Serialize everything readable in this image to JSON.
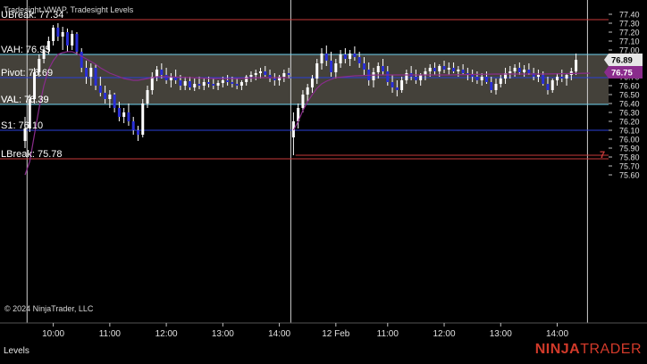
{
  "chart_data": {
    "type": "bar",
    "indicators_label": "Tradesight VWAP, Tradesight Levels",
    "copyright": "© 2024 NinjaTrader, LLC",
    "ylim": [
      75.55,
      77.42
    ],
    "y_ticks": [
      "77.40",
      "77.30",
      "77.20",
      "77.10",
      "77.00",
      "76.90",
      "76.80",
      "76.70",
      "76.60",
      "76.50",
      "76.40",
      "76.30",
      "76.20",
      "76.10",
      "76.00",
      "75.90",
      "75.80",
      "75.70",
      "75.60"
    ],
    "x_ticks": [
      {
        "label": "10:00",
        "slot": 6
      },
      {
        "label": "11:00",
        "slot": 18
      },
      {
        "label": "12:00",
        "slot": 30
      },
      {
        "label": "13:00",
        "slot": 42
      },
      {
        "label": "14:00",
        "slot": 54
      },
      {
        "label": "12 Feb",
        "slot": 66
      },
      {
        "label": "11:00",
        "slot": 77
      },
      {
        "label": "12:00",
        "slot": 89
      },
      {
        "label": "13:00",
        "slot": 101
      },
      {
        "label": "14:00",
        "slot": 113
      }
    ],
    "session_breaks": [
      1,
      57,
      120
    ],
    "value_area": {
      "high": 76.95,
      "low": 76.39
    },
    "levels": [
      {
        "name": "UBreak",
        "label": "UBreak: 77.34",
        "value": 77.34,
        "color": "#c83a3a"
      },
      {
        "name": "VAH",
        "label": "VAH: 76.95",
        "value": 76.95,
        "color": "#6fd4f0"
      },
      {
        "name": "Pivot",
        "label": "Pivot: 76.69",
        "value": 76.69,
        "color": "#2a3fd8"
      },
      {
        "name": "VAL",
        "label": "VAL: 76.39",
        "value": 76.39,
        "color": "#6fd4f0"
      },
      {
        "name": "S1",
        "label": "S1: 76.10",
        "value": 76.1,
        "color": "#2a3fd8"
      },
      {
        "name": "LBreak",
        "label": "LBreak: 75.78",
        "value": 75.78,
        "color": "#c83a3a"
      }
    ],
    "overlap_label": "VAL: 76.39",
    "extra_line": {
      "value": 75.82,
      "from_slot": 58,
      "label": "7",
      "color": "#c83a3a"
    },
    "price_markers": [
      {
        "label": "76.89",
        "value": 76.89,
        "bg": "#e6e6e6",
        "fg": "#000000"
      },
      {
        "label": "76.75",
        "value": 76.75,
        "bg": "#8a2c8c",
        "fg": "#ffffff"
      }
    ],
    "bars": [
      [
        75.98,
        76.25,
        75.9,
        76.12
      ],
      [
        76.12,
        76.5,
        76.08,
        76.45
      ],
      [
        76.45,
        76.8,
        76.4,
        76.75
      ],
      [
        76.75,
        76.95,
        76.7,
        76.9
      ],
      [
        76.9,
        77.05,
        76.85,
        77.0
      ],
      [
        77.0,
        77.15,
        76.95,
        77.1
      ],
      [
        77.1,
        77.28,
        77.05,
        77.25
      ],
      [
        77.25,
        77.3,
        77.1,
        77.15
      ],
      [
        77.15,
        77.26,
        77.0,
        77.2
      ],
      [
        77.2,
        77.24,
        76.98,
        77.05
      ],
      [
        77.05,
        77.22,
        77.0,
        77.18
      ],
      [
        77.18,
        77.2,
        76.95,
        76.98
      ],
      [
        76.98,
        77.02,
        76.75,
        76.8
      ],
      [
        76.8,
        76.88,
        76.62,
        76.7
      ],
      [
        76.7,
        76.85,
        76.6,
        76.8
      ],
      [
        76.8,
        76.84,
        76.55,
        76.6
      ],
      [
        76.6,
        76.7,
        76.48,
        76.52
      ],
      [
        76.52,
        76.6,
        76.4,
        76.45
      ],
      [
        76.45,
        76.55,
        76.35,
        76.5
      ],
      [
        76.5,
        76.52,
        76.3,
        76.35
      ],
      [
        76.35,
        76.42,
        76.2,
        76.25
      ],
      [
        76.25,
        76.35,
        76.18,
        76.3
      ],
      [
        76.3,
        76.4,
        76.15,
        76.2
      ],
      [
        76.2,
        76.25,
        76.05,
        76.1
      ],
      [
        76.1,
        76.15,
        75.98,
        76.05
      ],
      [
        76.05,
        76.45,
        76.02,
        76.4
      ],
      [
        76.4,
        76.6,
        76.35,
        76.55
      ],
      [
        76.55,
        76.75,
        76.5,
        76.7
      ],
      [
        76.7,
        76.82,
        76.65,
        76.78
      ],
      [
        76.78,
        76.85,
        76.68,
        76.72
      ],
      [
        76.72,
        76.8,
        76.62,
        76.66
      ],
      [
        76.66,
        76.74,
        76.58,
        76.7
      ],
      [
        76.7,
        76.78,
        76.62,
        76.66
      ],
      [
        76.66,
        76.72,
        76.55,
        76.6
      ],
      [
        76.6,
        76.7,
        76.55,
        76.65
      ],
      [
        76.65,
        76.7,
        76.55,
        76.58
      ],
      [
        76.58,
        76.68,
        76.54,
        76.62
      ],
      [
        76.62,
        76.7,
        76.56,
        76.6
      ],
      [
        76.6,
        76.68,
        76.55,
        76.64
      ],
      [
        76.64,
        76.7,
        76.58,
        76.62
      ],
      [
        76.62,
        76.68,
        76.56,
        76.6
      ],
      [
        76.6,
        76.66,
        76.55,
        76.63
      ],
      [
        76.63,
        76.7,
        76.58,
        76.66
      ],
      [
        76.66,
        76.72,
        76.6,
        76.64
      ],
      [
        76.64,
        76.7,
        76.58,
        76.62
      ],
      [
        76.62,
        76.68,
        76.56,
        76.6
      ],
      [
        76.6,
        76.66,
        76.55,
        76.64
      ],
      [
        76.64,
        76.72,
        76.6,
        76.7
      ],
      [
        76.7,
        76.76,
        76.64,
        76.72
      ],
      [
        76.72,
        76.78,
        76.66,
        76.74
      ],
      [
        76.74,
        76.8,
        76.68,
        76.76
      ],
      [
        76.76,
        76.82,
        76.7,
        76.72
      ],
      [
        76.72,
        76.78,
        76.64,
        76.68
      ],
      [
        76.68,
        76.74,
        76.6,
        76.66
      ],
      [
        76.66,
        76.72,
        76.6,
        76.7
      ],
      [
        76.7,
        76.78,
        76.64,
        76.74
      ],
      [
        76.74,
        76.8,
        76.68,
        76.72
      ],
      [
        76.02,
        76.3,
        75.82,
        76.2
      ],
      [
        76.2,
        76.4,
        76.12,
        76.35
      ],
      [
        76.35,
        76.55,
        76.3,
        76.5
      ],
      [
        76.5,
        76.62,
        76.42,
        76.58
      ],
      [
        76.58,
        76.72,
        76.52,
        76.68
      ],
      [
        76.68,
        76.9,
        76.62,
        76.85
      ],
      [
        76.85,
        77.02,
        76.78,
        76.96
      ],
      [
        76.96,
        77.05,
        76.82,
        76.88
      ],
      [
        76.88,
        76.98,
        76.7,
        76.75
      ],
      [
        76.75,
        76.9,
        76.68,
        76.85
      ],
      [
        76.85,
        77.0,
        76.8,
        76.95
      ],
      [
        76.95,
        77.02,
        76.85,
        76.9
      ],
      [
        76.9,
        77.0,
        76.82,
        76.96
      ],
      [
        76.96,
        77.04,
        76.88,
        76.92
      ],
      [
        76.92,
        76.98,
        76.8,
        76.85
      ],
      [
        76.85,
        76.92,
        76.72,
        76.78
      ],
      [
        76.78,
        76.86,
        76.6,
        76.66
      ],
      [
        76.66,
        76.8,
        76.58,
        76.75
      ],
      [
        76.75,
        76.86,
        76.68,
        76.82
      ],
      [
        76.82,
        76.9,
        76.72,
        76.76
      ],
      [
        76.76,
        76.82,
        76.6,
        76.64
      ],
      [
        76.64,
        76.72,
        76.52,
        76.58
      ],
      [
        76.58,
        76.66,
        76.48,
        76.55
      ],
      [
        76.55,
        76.7,
        76.52,
        76.66
      ],
      [
        76.66,
        76.78,
        76.62,
        76.74
      ],
      [
        76.74,
        76.82,
        76.66,
        76.7
      ],
      [
        76.7,
        76.78,
        76.62,
        76.66
      ],
      [
        76.66,
        76.74,
        76.6,
        76.72
      ],
      [
        76.72,
        76.8,
        76.66,
        76.76
      ],
      [
        76.76,
        76.84,
        76.7,
        76.8
      ],
      [
        76.8,
        76.86,
        76.72,
        76.76
      ],
      [
        76.76,
        76.84,
        76.7,
        76.82
      ],
      [
        76.82,
        76.88,
        76.74,
        76.78
      ],
      [
        76.78,
        76.86,
        76.72,
        76.8
      ],
      [
        76.8,
        76.86,
        76.74,
        76.76
      ],
      [
        76.76,
        76.82,
        76.7,
        76.78
      ],
      [
        76.78,
        76.84,
        76.72,
        76.74
      ],
      [
        76.74,
        76.8,
        76.66,
        76.72
      ],
      [
        76.72,
        76.78,
        76.64,
        76.7
      ],
      [
        76.7,
        76.76,
        76.62,
        76.66
      ],
      [
        76.66,
        76.74,
        76.6,
        76.7
      ],
      [
        76.7,
        76.76,
        76.62,
        76.64
      ],
      [
        76.64,
        76.7,
        76.52,
        76.55
      ],
      [
        76.55,
        76.68,
        76.5,
        76.62
      ],
      [
        76.62,
        76.72,
        76.58,
        76.68
      ],
      [
        76.68,
        76.8,
        76.62,
        76.74
      ],
      [
        76.74,
        76.82,
        76.68,
        76.76
      ],
      [
        76.76,
        76.84,
        76.7,
        76.8
      ],
      [
        76.8,
        76.86,
        76.72,
        76.75
      ],
      [
        76.75,
        76.83,
        76.7,
        76.78
      ],
      [
        76.78,
        76.85,
        76.72,
        76.74
      ],
      [
        76.74,
        76.8,
        76.66,
        76.7
      ],
      [
        76.7,
        76.78,
        76.64,
        76.72
      ],
      [
        76.72,
        76.76,
        76.6,
        76.62
      ],
      [
        76.62,
        76.7,
        76.5,
        76.55
      ],
      [
        76.55,
        76.68,
        76.52,
        76.66
      ],
      [
        76.66,
        76.74,
        76.6,
        76.7
      ],
      [
        76.7,
        76.78,
        76.64,
        76.68
      ],
      [
        76.68,
        76.74,
        76.6,
        76.72
      ],
      [
        76.72,
        76.8,
        76.66,
        76.76
      ],
      [
        76.76,
        76.96,
        76.72,
        76.89
      ]
    ],
    "vwap": [
      [
        0,
        75.6
      ],
      [
        1,
        75.75
      ],
      [
        2,
        76.05
      ],
      [
        3,
        76.35
      ],
      [
        4,
        76.6
      ],
      [
        5,
        76.78
      ],
      [
        6,
        76.88
      ],
      [
        7,
        76.95
      ],
      [
        8,
        76.97
      ],
      [
        9,
        76.98
      ],
      [
        10,
        76.98
      ],
      [
        11,
        76.96
      ],
      [
        12,
        76.93
      ],
      [
        13,
        76.9
      ],
      [
        14,
        76.87
      ],
      [
        15,
        76.84
      ],
      [
        16,
        76.8
      ],
      [
        17,
        76.77
      ],
      [
        18,
        76.74
      ],
      [
        19,
        76.72
      ],
      [
        20,
        76.7
      ],
      [
        21,
        76.68
      ],
      [
        22,
        76.67
      ],
      [
        23,
        76.66
      ],
      [
        24,
        76.66
      ],
      [
        25,
        76.67
      ],
      [
        26,
        76.68
      ],
      [
        27,
        76.69
      ],
      [
        28,
        76.7
      ],
      [
        30,
        76.7
      ],
      [
        35,
        76.69
      ],
      [
        40,
        76.68
      ],
      [
        45,
        76.68
      ],
      [
        50,
        76.69
      ],
      [
        56,
        76.69
      ],
      [
        57,
        76.1
      ],
      [
        58,
        76.2
      ],
      [
        59,
        76.32
      ],
      [
        60,
        76.42
      ],
      [
        61,
        76.5
      ],
      [
        62,
        76.57
      ],
      [
        63,
        76.62
      ],
      [
        64,
        76.65
      ],
      [
        65,
        76.67
      ],
      [
        66,
        76.69
      ],
      [
        68,
        76.7
      ],
      [
        70,
        76.71
      ],
      [
        75,
        76.72
      ],
      [
        80,
        76.72
      ],
      [
        90,
        76.72
      ],
      [
        100,
        76.73
      ],
      [
        110,
        76.73
      ],
      [
        120,
        76.74
      ]
    ]
  }
}
